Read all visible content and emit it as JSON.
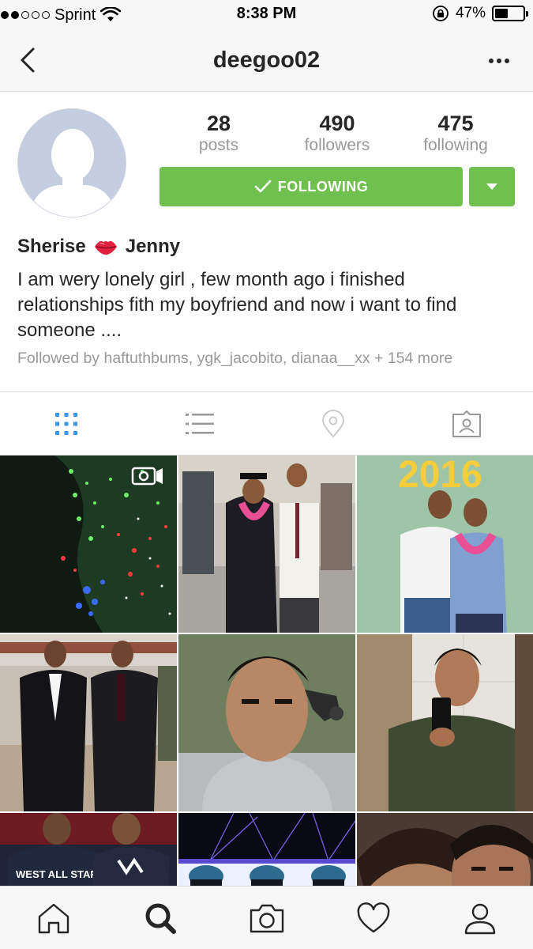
{
  "status_bar": {
    "carrier": "Sprint",
    "time": "8:38 PM",
    "battery": "47%",
    "battery_level": 0.47
  },
  "nav": {
    "username": "deegoo02"
  },
  "stats": {
    "posts": {
      "value": "28",
      "label": "posts"
    },
    "followers": {
      "value": "490",
      "label": "followers"
    },
    "following": {
      "value": "475",
      "label": "following"
    }
  },
  "follow_button": {
    "label": "FOLLOWING"
  },
  "profile": {
    "name_first": "Sherise",
    "name_second": "Jenny",
    "bio": "I am wery lonely girl , few month ago i finished relationships fith my boyfriend and now i want to find someone ....",
    "followed_by": "Followed by haftuthbums, ygk_jacobito, dianaa__xx + 154 more"
  },
  "tabs": [
    "grid-icon",
    "list-icon",
    "location-pin-icon",
    "tagged-photos-icon"
  ],
  "grid": {
    "photos": [
      {
        "kind": "video",
        "overlay": ""
      },
      {
        "kind": "photo",
        "overlay": ""
      },
      {
        "kind": "photo",
        "overlay": "2016"
      },
      {
        "kind": "photo",
        "overlay": ""
      },
      {
        "kind": "photo",
        "overlay": ""
      },
      {
        "kind": "photo",
        "overlay": ""
      },
      {
        "kind": "photo",
        "overlay": "WEST ALL STARS"
      },
      {
        "kind": "photo",
        "overlay": ""
      },
      {
        "kind": "photo",
        "overlay": ""
      }
    ]
  },
  "bottom_bar": [
    "home-icon",
    "search-icon",
    "camera-icon",
    "heart-icon",
    "profile-icon"
  ],
  "colors": {
    "accent": "#70c050",
    "active_tab": "#3897f0",
    "muted": "#999999",
    "text": "#262626"
  }
}
